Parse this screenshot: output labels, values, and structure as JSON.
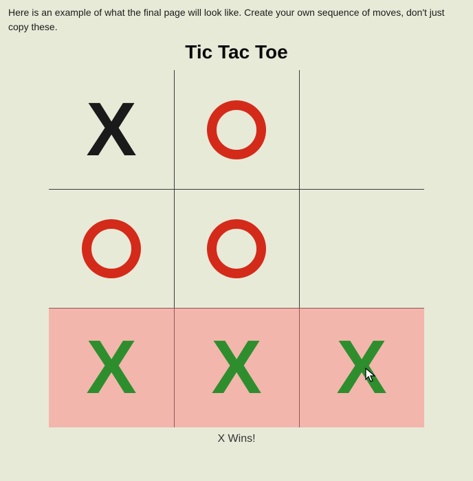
{
  "instructions": "Here is an example of what the final page will look like. Create your own sequence of moves, don't just copy these.",
  "title": "Tic Tac Toe",
  "status": "X Wins!",
  "colors": {
    "x_first": "#1a1a1a",
    "o": "#d42a1a",
    "x_win": "#2e8e2e"
  },
  "board": [
    [
      {
        "mark": "X",
        "color": "x_first"
      },
      {
        "mark": "O",
        "color": "o"
      },
      {
        "mark": "",
        "color": ""
      }
    ],
    [
      {
        "mark": "O",
        "color": "o"
      },
      {
        "mark": "O",
        "color": "o"
      },
      {
        "mark": "",
        "color": ""
      }
    ],
    [
      {
        "mark": "X",
        "color": "x_win"
      },
      {
        "mark": "X",
        "color": "x_win"
      },
      {
        "mark": "X",
        "color": "x_win"
      }
    ]
  ],
  "winning_row": 2
}
